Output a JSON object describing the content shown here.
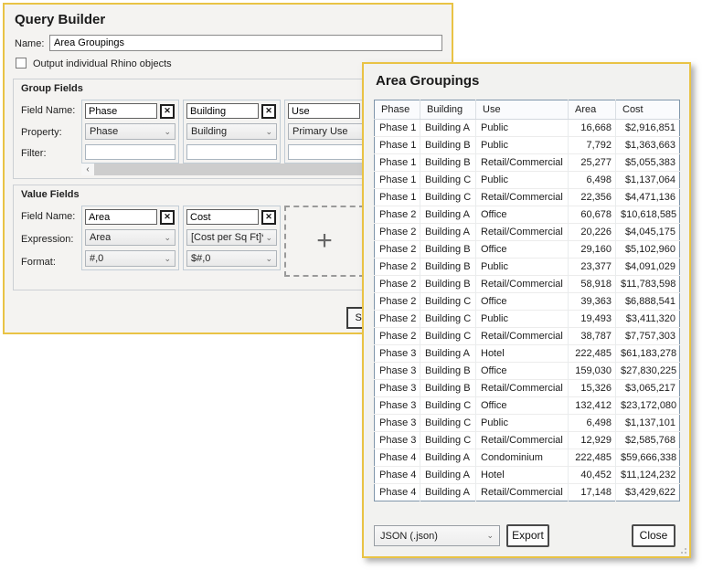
{
  "colors": {
    "window_border": "#e9c345",
    "window_bg": "#f4f3f1",
    "table_border": "#8096ab"
  },
  "query_builder": {
    "title": "Query Builder",
    "name_label": "Name:",
    "name_value": "Area Groupings",
    "checkbox_label": "Output individual Rhino objects",
    "group_fields": {
      "title": "Group Fields",
      "row_labels": [
        "Field Name:",
        "Property:",
        "Filter:"
      ],
      "columns": [
        {
          "field_name": "Phase",
          "property": "Phase",
          "filter": ""
        },
        {
          "field_name": "Building",
          "property": "Building",
          "filter": ""
        },
        {
          "field_name": "Use",
          "property": "Primary Use",
          "filter": ""
        }
      ],
      "remove_glyph": "✕",
      "scroll_left_glyph": "‹"
    },
    "value_fields": {
      "title": "Value Fields",
      "row_labels": [
        "Field Name:",
        "Expression:",
        "Format:"
      ],
      "columns": [
        {
          "field_name": "Area",
          "expression": "Area",
          "format": "#,0"
        },
        {
          "field_name": "Cost",
          "expression": "[Cost per Sq Ft]*[A",
          "format": "$#,0"
        }
      ],
      "add_glyph": "+",
      "remove_glyph": "✕"
    },
    "save_label": "Save"
  },
  "results_window": {
    "title": "Area Groupings",
    "table": {
      "columns": [
        "Phase",
        "Building",
        "Use",
        "Area",
        "Cost"
      ],
      "rows": [
        [
          "Phase 1",
          "Building A",
          "Public",
          "16,668",
          "$2,916,851"
        ],
        [
          "Phase 1",
          "Building B",
          "Public",
          "7,792",
          "$1,363,663"
        ],
        [
          "Phase 1",
          "Building B",
          "Retail/Commercial",
          "25,277",
          "$5,055,383"
        ],
        [
          "Phase 1",
          "Building C",
          "Public",
          "6,498",
          "$1,137,064"
        ],
        [
          "Phase 1",
          "Building C",
          "Retail/Commercial",
          "22,356",
          "$4,471,136"
        ],
        [
          "Phase 2",
          "Building A",
          "Office",
          "60,678",
          "$10,618,585"
        ],
        [
          "Phase 2",
          "Building A",
          "Retail/Commercial",
          "20,226",
          "$4,045,175"
        ],
        [
          "Phase 2",
          "Building B",
          "Office",
          "29,160",
          "$5,102,960"
        ],
        [
          "Phase 2",
          "Building B",
          "Public",
          "23,377",
          "$4,091,029"
        ],
        [
          "Phase 2",
          "Building B",
          "Retail/Commercial",
          "58,918",
          "$11,783,598"
        ],
        [
          "Phase 2",
          "Building C",
          "Office",
          "39,363",
          "$6,888,541"
        ],
        [
          "Phase 2",
          "Building C",
          "Public",
          "19,493",
          "$3,411,320"
        ],
        [
          "Phase 2",
          "Building C",
          "Retail/Commercial",
          "38,787",
          "$7,757,303"
        ],
        [
          "Phase 3",
          "Building A",
          "Hotel",
          "222,485",
          "$61,183,278"
        ],
        [
          "Phase 3",
          "Building B",
          "Office",
          "159,030",
          "$27,830,225"
        ],
        [
          "Phase 3",
          "Building B",
          "Retail/Commercial",
          "15,326",
          "$3,065,217"
        ],
        [
          "Phase 3",
          "Building C",
          "Office",
          "132,412",
          "$23,172,080"
        ],
        [
          "Phase 3",
          "Building C",
          "Public",
          "6,498",
          "$1,137,101"
        ],
        [
          "Phase 3",
          "Building C",
          "Retail/Commercial",
          "12,929",
          "$2,585,768"
        ],
        [
          "Phase 4",
          "Building A",
          "Condominium",
          "222,485",
          "$59,666,338"
        ],
        [
          "Phase 4",
          "Building A",
          "Hotel",
          "40,452",
          "$11,124,232"
        ],
        [
          "Phase 4",
          "Building A",
          "Retail/Commercial",
          "17,148",
          "$3,429,622"
        ]
      ]
    },
    "format_value": "JSON (.json)",
    "export_label": "Export",
    "close_label": "Close"
  }
}
